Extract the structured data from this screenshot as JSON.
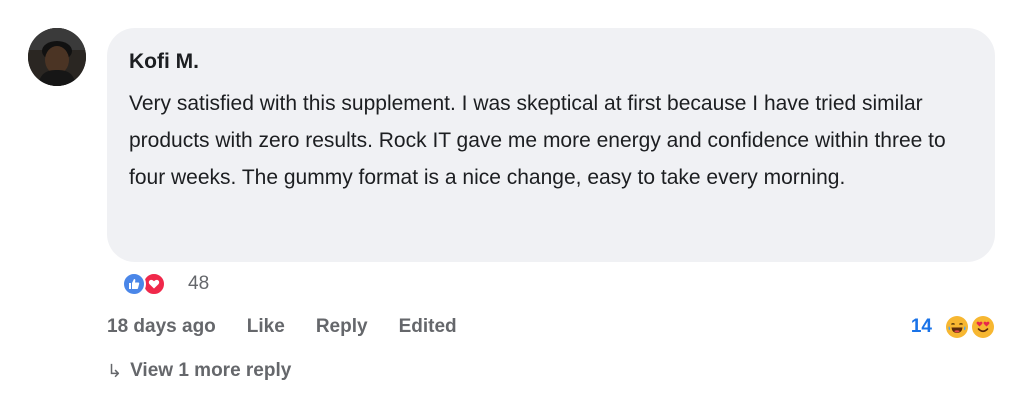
{
  "comment": {
    "author": "Kofi M.",
    "text": "Very satisfied with this supplement. I was skeptical at first because I have tried similar products with zero results. Rock IT gave me more energy and confidence within three to four weeks. The gummy format is a nice change, easy to take every morning.",
    "reaction_count": "48",
    "reaction_icons": [
      "thumbs-up-icon",
      "heart-icon"
    ]
  },
  "actions": {
    "time": "18 days ago",
    "like_label": "Like",
    "reply_label": "Reply",
    "edited_label": "Edited"
  },
  "right_reactions": {
    "count": "14",
    "icons": [
      "laughing-face-icon",
      "heart-eyes-face-icon"
    ]
  },
  "replies": {
    "arrow": "↳",
    "view_more_label": "View 1 more reply"
  },
  "colors": {
    "bubble_bg": "#f0f1f4",
    "text": "#1c1e21",
    "muted": "#65676b",
    "like_blue": "#4a86e8",
    "love_red": "#f0284a",
    "count_blue": "#1a73e8",
    "emoji_yellow": "#f7b731"
  }
}
